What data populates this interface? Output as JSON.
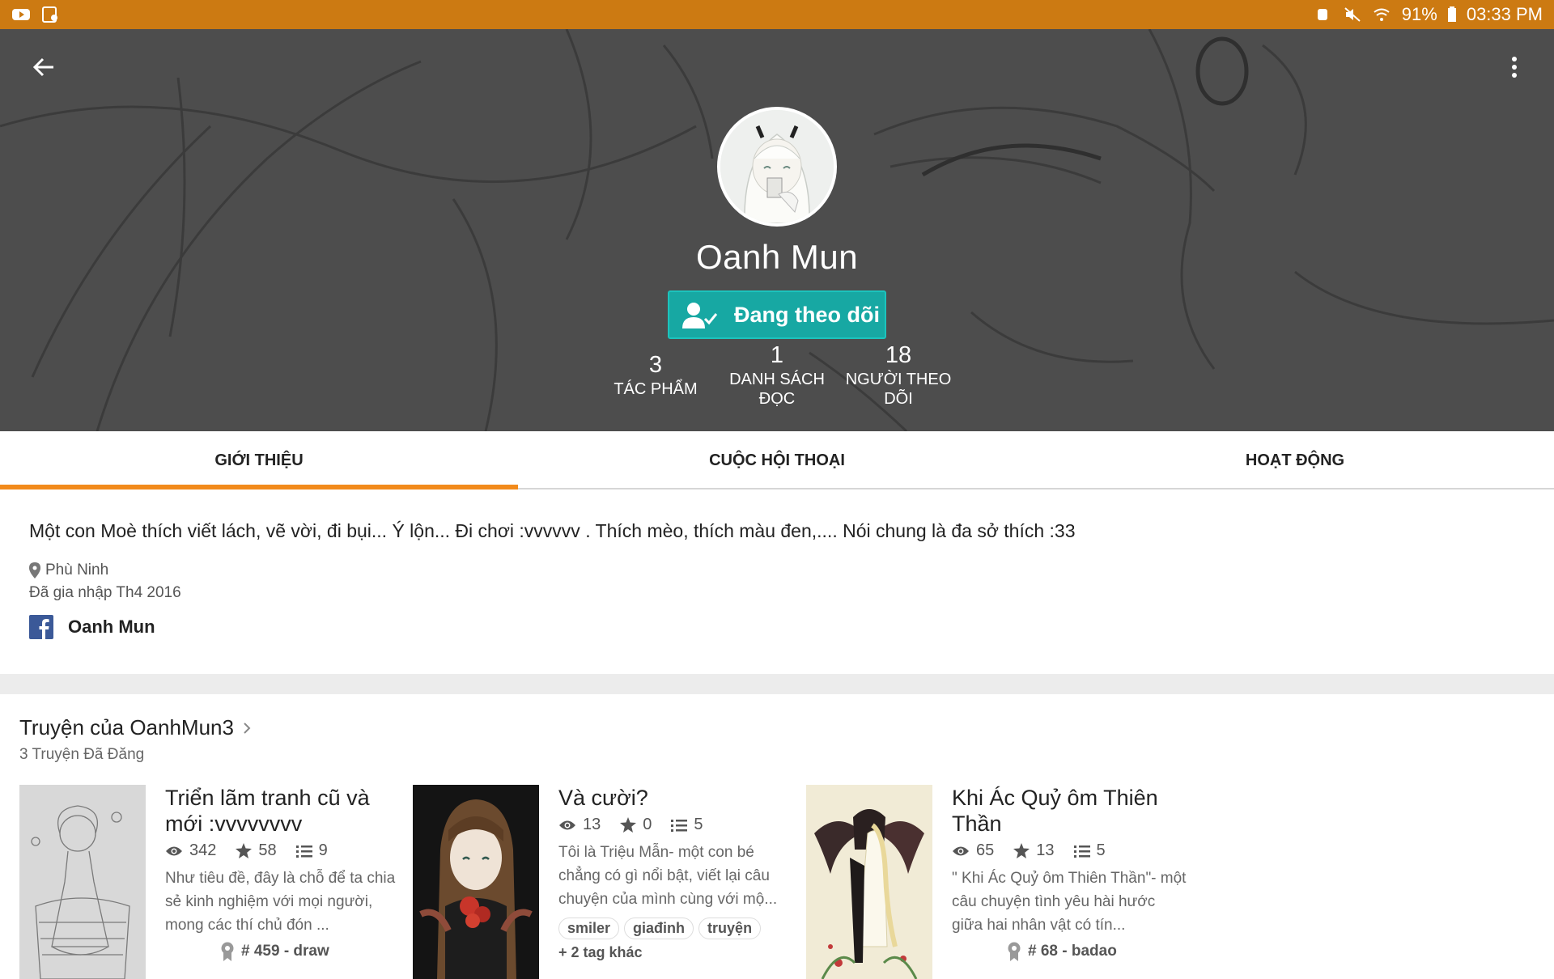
{
  "status_bar": {
    "battery": "91%",
    "time": "03:33 PM"
  },
  "profile": {
    "name": "Oanh Mun",
    "follow_label": "Đang theo dõi",
    "stats": [
      {
        "value": "3",
        "label_1": "TÁC PHẨM",
        "label_2": ""
      },
      {
        "value": "1",
        "label_1": "DANH SÁCH",
        "label_2": "ĐỌC"
      },
      {
        "value": "18",
        "label_1": "NGƯỜI THEO",
        "label_2": "DÕI"
      }
    ]
  },
  "tabs": [
    {
      "label": "GIỚI THIỆU",
      "active": true
    },
    {
      "label": "CUỘC HỘI THOẠI",
      "active": false
    },
    {
      "label": "HOẠT ĐỘNG",
      "active": false
    }
  ],
  "about": {
    "bio": "Một con Moè thích viết lách, vẽ vời, đi bụi... Ý lộn... Đi chơi :vvvvvv . Thích mèo, thích màu đen,.... Nói chung là đa sở thích :33",
    "location": "Phù Ninh",
    "joined": "Đã gia nhập Th4 2016",
    "facebook_name": "Oanh Mun"
  },
  "stories_section": {
    "title": "Truyện của OanhMun3",
    "subtitle": "3 Truyện Đã Đăng",
    "items": [
      {
        "title": "Triển lãm tranh cũ và mới :vvvvvvvv",
        "reads": "342",
        "votes": "58",
        "parts": "9",
        "description": "Như tiêu đề, đây là chỗ để ta chia sẻ kinh nghiệm với mọi người, mong các thí chủ đón ...",
        "rank": "# 459 - draw"
      },
      {
        "title": "Và cười?",
        "reads": "13",
        "votes": "0",
        "parts": "5",
        "description": "Tôi là Triệu Mẫn- một con bé chẳng có gì nổi bật, viết lại câu chuyện của mình cùng với mộ...",
        "tags": [
          "smiler",
          "giađinh",
          "truyện"
        ],
        "more_tags": "+ 2 tag khác"
      },
      {
        "title": "Khi Ác Quỷ ôm Thiên Thần",
        "reads": "65",
        "votes": "13",
        "parts": "5",
        "description": "\" Khi Ác Quỷ ôm Thiên Thần\"- một câu chuyện tình yêu hài hước giữa hai nhân vật có tín...",
        "rank": "# 68 - badao"
      }
    ]
  },
  "colors": {
    "status_bar": "#cc7a12",
    "accent": "#f28a1b",
    "follow": "#17a8a3"
  }
}
